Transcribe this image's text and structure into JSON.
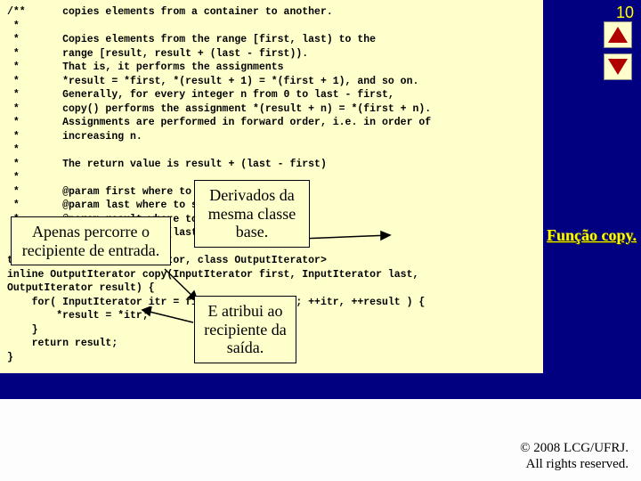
{
  "slideNumber": "10",
  "code": "/**      copies elements from a container to another.\n *\n *       Copies elements from the range [first, last) to the\n *       range [result, result + (last - first)).\n *       That is, it performs the assignments\n *       *result = *first, *(result + 1) = *(first + 1), and so on.\n *       Generally, for every integer n from 0 to last - first,\n *       copy() performs the assignment *(result + n) = *(first + n).\n *       Assignments are performed in forward order, i.e. in order of\n *       increasing n.\n *\n *       The return value is result + (last - first)\n *\n *       @param first where to start.\n *       @param last where to stop.\n *       @param result where to copy.\n *       @return result + (last - first).\n */\ntemplate <class InputIterator, class OutputIterator>\ninline OutputIterator copy(InputIterator first, InputIterator last,\nOutputIterator result) {\n    for( InputIterator itr = first; itr != last; ++itr, ++result ) {\n        *result = *itr;\n    }\n    return result;\n}",
  "callout1": "Apenas percorre o recipiente de entrada.",
  "callout2": "Derivados da mesma classe base.",
  "callout3": "E atribui ao recipiente da saída.",
  "sideLabel": "Função copy.",
  "footerLine1": "© 2008 LCG/UFRJ.",
  "footerLine2": "All rights reserved."
}
